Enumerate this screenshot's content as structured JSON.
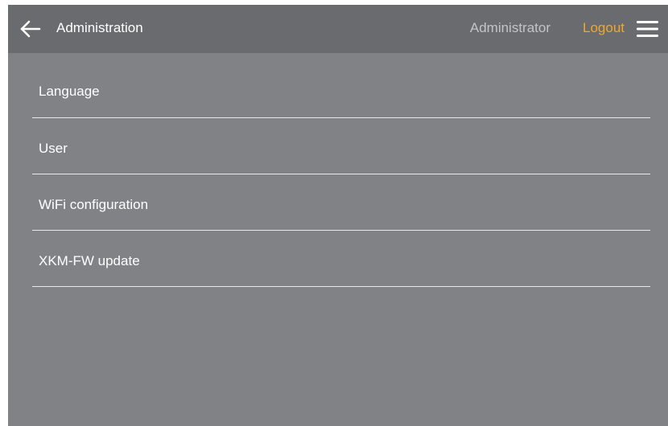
{
  "header": {
    "back_icon": "arrow-left-icon",
    "title": "Administration",
    "user": "Administrator",
    "logout_label": "Logout",
    "menu_icon": "hamburger-menu-icon"
  },
  "colors": {
    "header_bg": "#6a6b6e",
    "body_bg": "#818285",
    "accent": "#f1a728",
    "divider": "#e9e9ea"
  },
  "menu": {
    "items": [
      {
        "label": "Language"
      },
      {
        "label": "User"
      },
      {
        "label": "WiFi configuration"
      },
      {
        "label": "XKM-FW update"
      }
    ]
  }
}
